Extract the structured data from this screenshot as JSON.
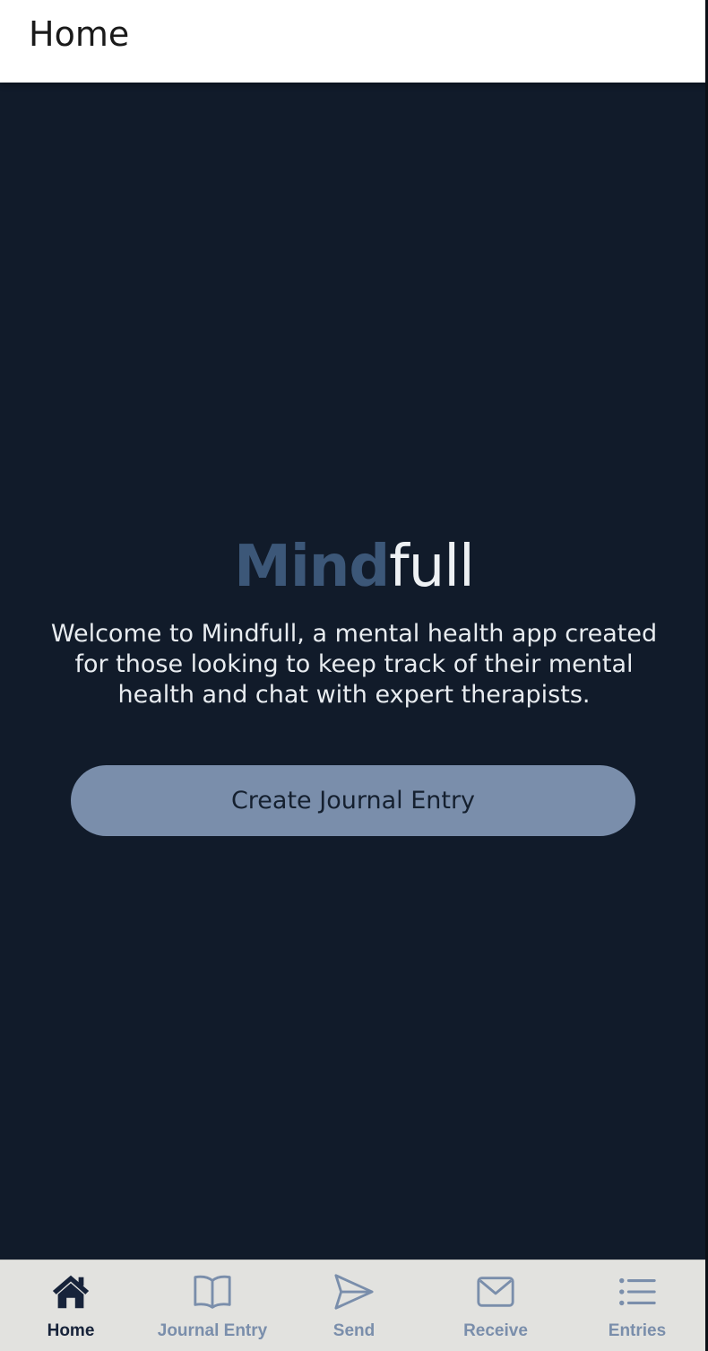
{
  "header": {
    "title": "Home"
  },
  "main": {
    "logo_part1": "Mind",
    "logo_part2": "full",
    "welcome_text": "Welcome to Mindfull, a mental health app created for those looking to keep track of their mental health and chat with expert therapists.",
    "cta_label": "Create Journal Entry"
  },
  "tabs": [
    {
      "label": "Home",
      "icon": "home-icon",
      "active": true
    },
    {
      "label": "Journal Entry",
      "icon": "book-icon",
      "active": false
    },
    {
      "label": "Send",
      "icon": "send-icon",
      "active": false
    },
    {
      "label": "Receive",
      "icon": "mail-icon",
      "active": false
    },
    {
      "label": "Entries",
      "icon": "list-icon",
      "active": false
    }
  ],
  "colors": {
    "background": "#111b2a",
    "accent": "#7a8eab",
    "logo_dark": "#3c5778",
    "tab_active": "#17233a"
  }
}
